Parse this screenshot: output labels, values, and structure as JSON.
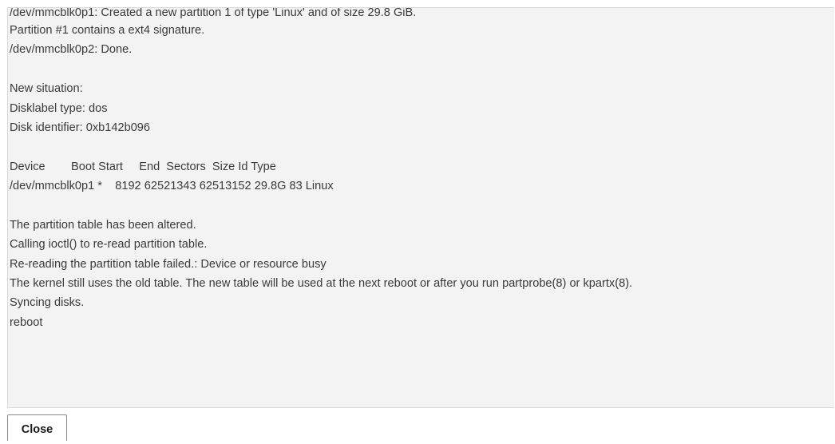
{
  "output": {
    "lines": [
      "/dev/mmcblk0p1: Created a new partition 1 of type 'Linux' and of size 29.8 GiB.",
      "Partition #1 contains a ext4 signature.",
      "/dev/mmcblk0p2: Done.",
      "",
      "New situation:",
      "Disklabel type: dos",
      "Disk identifier: 0xb142b096",
      "",
      "Device        Boot Start     End  Sectors  Size Id Type",
      "/dev/mmcblk0p1 *    8192 62521343 62513152 29.8G 83 Linux",
      "",
      "The partition table has been altered.",
      "Calling ioctl() to re-read partition table.",
      "Re-reading the partition table failed.: Device or resource busy",
      "The kernel still uses the old table. The new table will be used at the next reboot or after you run partprobe(8) or kpartx(8).",
      "Syncing disks.",
      "reboot"
    ]
  },
  "dialog": {
    "close_label": "Close"
  }
}
